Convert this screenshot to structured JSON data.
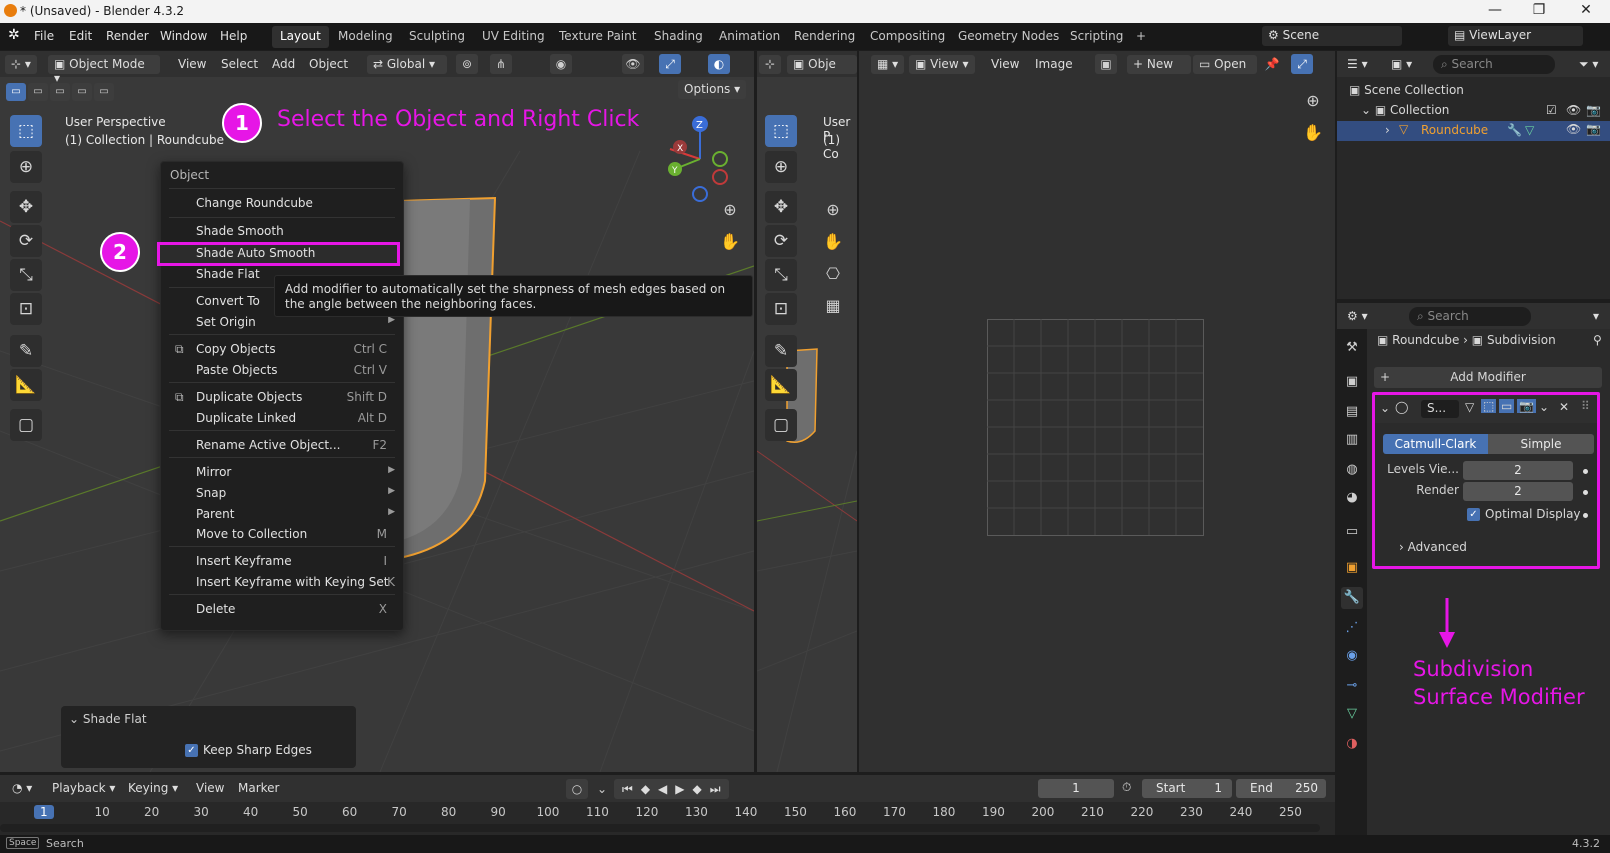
{
  "window": {
    "title": "* (Unsaved) - Blender 4.3.2",
    "minimize": "—",
    "maximize": "❐",
    "close": "✕"
  },
  "menubar": {
    "items": [
      "File",
      "Edit",
      "Render",
      "Window",
      "Help"
    ],
    "workspaces": [
      "Layout",
      "Modeling",
      "Sculpting",
      "UV Editing",
      "Texture Paint",
      "Shading",
      "Animation",
      "Rendering",
      "Compositing",
      "Geometry Nodes",
      "Scripting"
    ],
    "add_workspace": "+",
    "scene": "Scene",
    "view_layer": "ViewLayer"
  },
  "viewport": {
    "mode": "Object Mode",
    "menus": [
      "View",
      "Select",
      "Add",
      "Object"
    ],
    "transform_orientation": "Global",
    "options": "Options",
    "info_line1": "User Perspective",
    "info_line2": "(1) Collection | Roundcube",
    "second_mode": "Obje",
    "second_info1": "User P",
    "second_info2": "(1) Co"
  },
  "annotations": {
    "step1_num": "1",
    "step1_text": "Select the Object and Right Click",
    "step2_num": "2",
    "modifier_text_line1": "Subdivision",
    "modifier_text_line2": "Surface Modifier",
    "highlight_color": "#e616e6"
  },
  "context_menu": {
    "title": "Object",
    "items": [
      {
        "label": "Change Roundcube",
        "shortcut": "",
        "arrow": false
      },
      {
        "label": "Shade Smooth",
        "shortcut": "",
        "arrow": false
      },
      {
        "label": "Shade Auto Smooth",
        "shortcut": "",
        "arrow": false
      },
      {
        "label": "Shade Flat",
        "shortcut": "",
        "arrow": false
      },
      {
        "label": "Convert To",
        "shortcut": "",
        "arrow": true
      },
      {
        "label": "Set Origin",
        "shortcut": "",
        "arrow": true
      },
      {
        "label": "Copy Objects",
        "shortcut": "Ctrl C",
        "arrow": false
      },
      {
        "label": "Paste Objects",
        "shortcut": "Ctrl V",
        "arrow": false
      },
      {
        "label": "Duplicate Objects",
        "shortcut": "Shift D",
        "arrow": false
      },
      {
        "label": "Duplicate Linked",
        "shortcut": "Alt D",
        "arrow": false
      },
      {
        "label": "Rename Active Object...",
        "shortcut": "F2",
        "arrow": false
      },
      {
        "label": "Mirror",
        "shortcut": "",
        "arrow": true
      },
      {
        "label": "Snap",
        "shortcut": "",
        "arrow": true
      },
      {
        "label": "Parent",
        "shortcut": "",
        "arrow": true
      },
      {
        "label": "Move to Collection",
        "shortcut": "M",
        "arrow": false
      },
      {
        "label": "Insert Keyframe",
        "shortcut": "I",
        "arrow": false
      },
      {
        "label": "Insert Keyframe with Keying Set",
        "shortcut": "K",
        "arrow": false
      },
      {
        "label": "Delete",
        "shortcut": "X",
        "arrow": false
      }
    ],
    "tooltip": "Add modifier to automatically set the sharpness of mesh edges based on the angle between the neighboring faces."
  },
  "redo_panel": {
    "title": "Shade Flat",
    "option": "Keep Sharp Edges",
    "option_checked": true
  },
  "image_editor": {
    "menus": [
      "View",
      "View",
      "Image"
    ],
    "new": "New",
    "open": "Open"
  },
  "timeline": {
    "menus": [
      "Playback",
      "Keying",
      "View",
      "Marker"
    ],
    "current_frame": "1",
    "start_label": "Start",
    "start": "1",
    "end_label": "End",
    "end": "250",
    "ticks": [
      "1",
      "10",
      "20",
      "30",
      "40",
      "50",
      "60",
      "70",
      "80",
      "90",
      "100",
      "110",
      "120",
      "130",
      "140",
      "150",
      "160",
      "170",
      "180",
      "190",
      "200",
      "210",
      "220",
      "230",
      "240",
      "250"
    ]
  },
  "statusbar": {
    "key": "Space",
    "action": "Search",
    "version": "4.3.2"
  },
  "outliner": {
    "search_placeholder": "Search",
    "scene_collection": "Scene Collection",
    "collection": "Collection",
    "object": "Roundcube"
  },
  "properties": {
    "search_placeholder": "Search",
    "breadcrumb_object": "Roundcube",
    "breadcrumb_modifier": "Subdivision",
    "add_modifier": "Add Modifier",
    "modifier_name": "S...",
    "catmull_clark": "Catmull-Clark",
    "simple": "Simple",
    "levels_label": "Levels Vie...",
    "levels_value": "2",
    "render_label": "Render",
    "render_value": "2",
    "optimal_display": "Optimal Display",
    "advanced": "Advanced"
  }
}
